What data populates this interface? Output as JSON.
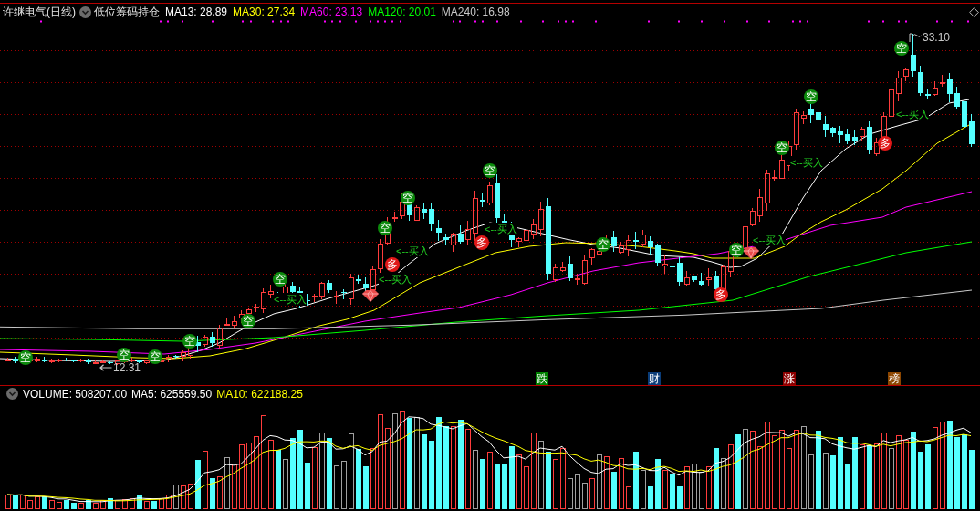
{
  "header": {
    "title": "许继电气(日线)",
    "indicator": "低位筹码持仓",
    "readings": [
      {
        "label": "MA13: 28.89",
        "color": "#ffffff"
      },
      {
        "label": "MA30: 27.34",
        "color": "#ffff00"
      },
      {
        "label": "MA60: 23.13",
        "color": "#ff00ff"
      },
      {
        "label": "MA120: 20.01",
        "color": "#00ff00"
      },
      {
        "label": "MA240: 16.98",
        "color": "#c8c8c8"
      }
    ]
  },
  "price_chart": {
    "high_label": "33.10",
    "low_label": "12.31",
    "signals": [
      {
        "kind": "short",
        "text": "空"
      },
      {
        "kind": "short",
        "text": "空"
      },
      {
        "kind": "short",
        "text": "空"
      },
      {
        "kind": "short",
        "text": "空"
      },
      {
        "kind": "short",
        "text": "空"
      },
      {
        "kind": "short",
        "text": "空"
      },
      {
        "kind": "short",
        "text": "空"
      },
      {
        "kind": "long",
        "text": "多"
      },
      {
        "kind": "short",
        "text": "空"
      },
      {
        "kind": "long",
        "text": "多"
      },
      {
        "kind": "short",
        "text": "空"
      },
      {
        "kind": "short",
        "text": "空"
      },
      {
        "kind": "long",
        "text": "多"
      },
      {
        "kind": "short",
        "text": "空"
      },
      {
        "kind": "short",
        "text": "空"
      },
      {
        "kind": "short",
        "text": "空"
      },
      {
        "kind": "long",
        "text": "多"
      },
      {
        "kind": "short",
        "text": "空"
      }
    ],
    "buy_signals": [
      {
        "text": "<--买入"
      },
      {
        "text": "<--买入"
      },
      {
        "text": "<--买入"
      },
      {
        "text": "<--买入"
      },
      {
        "text": "<--买入"
      },
      {
        "text": "<--买入"
      },
      {
        "text": "<--买入"
      }
    ],
    "events": [
      {
        "text": "跌",
        "color": "#008000"
      },
      {
        "text": "财",
        "color": "#0a3c78"
      },
      {
        "text": "涨",
        "color": "#8c0000"
      },
      {
        "text": "榜",
        "color": "#8c4600"
      }
    ]
  },
  "volume": {
    "readings": [
      {
        "label": "VOLUME: 508207.00",
        "color": "#ffffff"
      },
      {
        "label": "MA5: 625559.50",
        "color": "#ffffff"
      },
      {
        "label": "MA10: 622188.25",
        "color": "#ffff00"
      }
    ]
  }
}
